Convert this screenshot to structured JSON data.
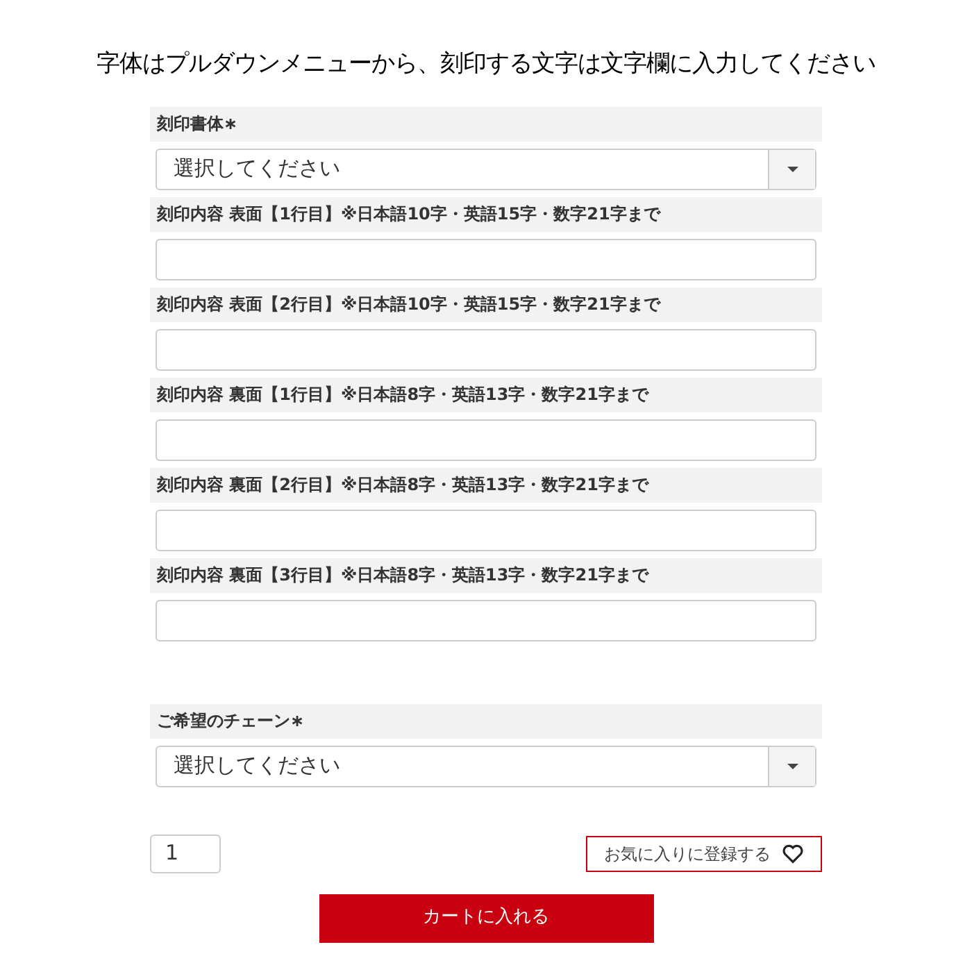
{
  "heading": "字体はプルダウンメニューから、刻印する文字は文字欄に入力してください",
  "fields": [
    {
      "kind": "select",
      "label": "刻印書体∗",
      "value": "選択してください"
    },
    {
      "kind": "text",
      "label": "刻印内容 表面【1行目】※日本語10字・英語15字・数字21字まで"
    },
    {
      "kind": "text",
      "label": "刻印内容 表面【2行目】※日本語10字・英語15字・数字21字まで"
    },
    {
      "kind": "text",
      "label": "刻印内容 裏面【1行目】※日本語8字・英語13字・数字21字まで"
    },
    {
      "kind": "text",
      "label": "刻印内容 裏面【2行目】※日本語8字・英語13字・数字21字まで"
    },
    {
      "kind": "text",
      "label": "刻印内容 裏面【3行目】※日本語8字・英語13字・数字21字まで"
    },
    {
      "kind": "spacer"
    },
    {
      "kind": "select",
      "label": "ご希望のチェーン∗",
      "value": "選択してください"
    }
  ],
  "quantity": "1",
  "favorite_button": "お気に入りに登録する",
  "cart_button": "カートに入れる"
}
